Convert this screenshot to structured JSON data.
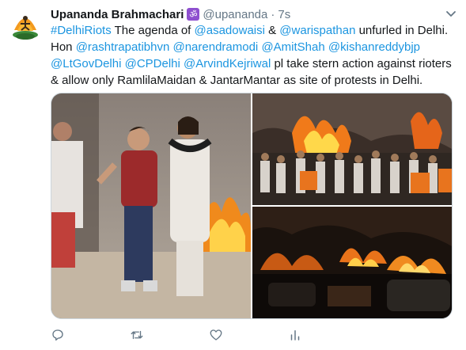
{
  "tweet": {
    "author": {
      "display_name": "Upananda Brahmachari",
      "badge_glyph": "ॐ",
      "handle": "@upananda",
      "separator": "·",
      "time": "7s"
    },
    "text": {
      "line1_hashtag": "#DelhiRiots",
      "line1_a": " The agenda of ",
      "mention_asadowaisi": "@asadowaisi",
      "line1_b": " & ",
      "mention_warispathan": "@warispathan",
      "line1_c": " unfurled in Delhi.",
      "hon": "Hon ",
      "mention_rashtrapatibhvn": "@rashtrapatibhvn",
      "mention_narendramodi": "@narendramodi",
      "mention_amitshah": "@AmitShah",
      "mention_kishanreddybjp": "@kishanreddybjp",
      "mention_ltgovdelhi": "@LtGovDelhi",
      "mention_cpdelhi": "@CPDelhi",
      "mention_arvindkejriwal": "@ArvindKejriwal",
      "line3_tail": "  pl take stern action against rioters",
      "line4": "& allow only RamlilaMaidan & JantarMantar as site of protests in Delhi."
    },
    "media": {
      "images": [
        "photo-street-clash",
        "photo-crowd-fire",
        "photo-night-blaze"
      ]
    },
    "actions": [
      "reply-icon",
      "retweet-icon",
      "like-icon",
      "analytics-icon"
    ]
  },
  "colors": {
    "link": "#1b95e0",
    "text": "#14171a",
    "muted": "#657786",
    "badge": "#8e4fcf"
  }
}
